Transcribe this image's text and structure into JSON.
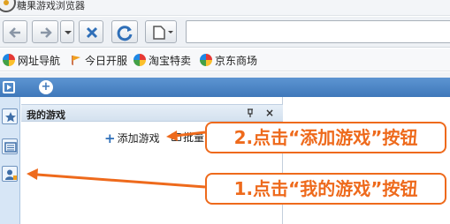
{
  "window": {
    "title": "糖果游戏浏览器"
  },
  "bookmarks": [
    {
      "label": "网址导航",
      "icon": "colorful-ball-icon"
    },
    {
      "label": "今日开服",
      "icon": "flag-icon"
    },
    {
      "label": "淘宝特卖",
      "icon": "colorful-ball-icon"
    },
    {
      "label": "京东商场",
      "icon": "colorful-ball-icon"
    }
  ],
  "games_panel": {
    "title": "我的游戏",
    "add_label": "添加游戏",
    "batch_label": "批量"
  },
  "annotations": {
    "step2": "2.点击“添加游戏”按钮",
    "step1": "1.点击“我的游戏”按钮"
  },
  "colors": {
    "accent": "#ee6a1c",
    "tabstrip": "#4a84c4",
    "sidebar": "#d7e6f6"
  }
}
